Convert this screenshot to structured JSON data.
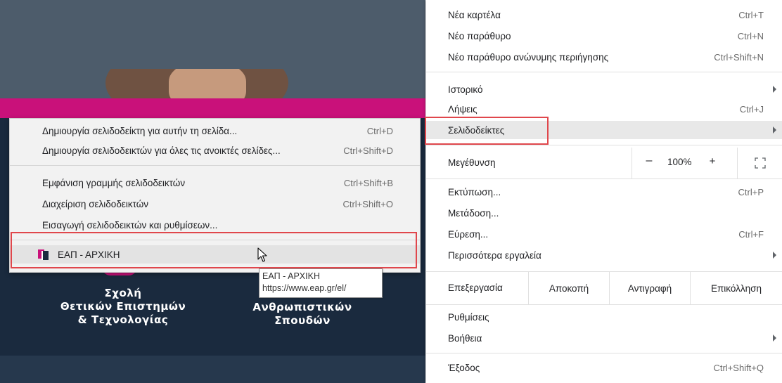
{
  "background_page": {
    "school_left": [
      "Σχολή",
      "Θετικών Επιστημών",
      "& Τεχνολογίας"
    ],
    "school_right": [
      "Ανθρωπιστικών",
      "Σπουδών"
    ],
    "colors": {
      "pink": "#c9117a",
      "navy": "#1a2a3e",
      "slate": "#4d5c6b"
    }
  },
  "tooltip": {
    "title": "ΕΑΠ - ΑΡΧΙΚΗ",
    "url": "https://www.eap.gr/el/"
  },
  "bookmarks_submenu": {
    "items": [
      {
        "label": "Δημιουργία σελιδοδείκτη για αυτήν τη σελίδα...",
        "shortcut": "Ctrl+D"
      },
      {
        "label": "Δημιουργία σελιδοδεικτών για όλες τις ανοικτές σελίδες...",
        "shortcut": "Ctrl+Shift+D"
      },
      {
        "label": "Εμφάνιση γραμμής σελιδοδεικτών",
        "shortcut": "Ctrl+Shift+B"
      },
      {
        "label": "Διαχείριση σελιδοδεικτών",
        "shortcut": "Ctrl+Shift+O"
      },
      {
        "label": "Εισαγωγή σελιδοδεικτών και ρυθμίσεων...",
        "shortcut": ""
      }
    ],
    "bookmark": {
      "label": "ΕΑΠ - ΑΡΧΙΚΗ",
      "icon": "eap-favicon"
    }
  },
  "menu": {
    "new_tab": {
      "label": "Νέα καρτέλα",
      "shortcut": "Ctrl+T"
    },
    "new_window": {
      "label": "Νέο παράθυρο",
      "shortcut": "Ctrl+N"
    },
    "incognito": {
      "label": "Νέο παράθυρο ανώνυμης περιήγησης",
      "shortcut": "Ctrl+Shift+N"
    },
    "history": {
      "label": "Ιστορικό"
    },
    "downloads": {
      "label": "Λήψεις",
      "shortcut": "Ctrl+J"
    },
    "bookmarks": {
      "label": "Σελιδοδείκτες"
    },
    "zoom": {
      "label": "Μεγέθυνση",
      "minus": "–",
      "value": "100%",
      "plus": "+"
    },
    "print": {
      "label": "Εκτύπωση...",
      "shortcut": "Ctrl+P"
    },
    "cast": {
      "label": "Μετάδοση..."
    },
    "find": {
      "label": "Εύρεση...",
      "shortcut": "Ctrl+F"
    },
    "more_tools": {
      "label": "Περισσότερα εργαλεία"
    },
    "edit": {
      "label": "Επεξεργασία",
      "cut": "Αποκοπή",
      "copy": "Αντιγραφή",
      "paste": "Επικόλληση"
    },
    "settings": {
      "label": "Ρυθμίσεις"
    },
    "help": {
      "label": "Βοήθεια"
    },
    "exit": {
      "label": "Έξοδος",
      "shortcut": "Ctrl+Shift+Q"
    }
  },
  "highlight_color": "#e0474c"
}
